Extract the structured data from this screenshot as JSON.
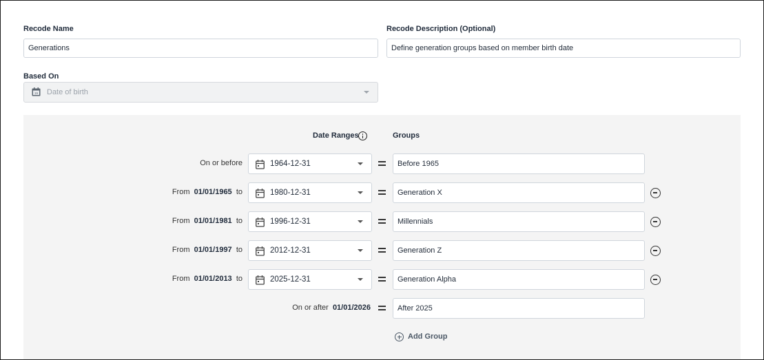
{
  "form": {
    "recode_name_label": "Recode Name",
    "recode_name_value": "Generations",
    "description_label": "Recode Description (Optional)",
    "description_value": "Define generation groups based on member birth date",
    "based_on_label": "Based On",
    "based_on_value": "Date of birth"
  },
  "table": {
    "date_ranges_header": "Date Ranges",
    "groups_header": "Groups",
    "add_group_label": "Add Group",
    "rows": [
      {
        "prefix": "On or before",
        "from": "",
        "to_word": "",
        "date": "1964-12-31",
        "group": "Before 1965",
        "removable": false
      },
      {
        "prefix": "From",
        "from": "01/01/1965",
        "to_word": "to",
        "date": "1980-12-31",
        "group": "Generation X",
        "removable": true
      },
      {
        "prefix": "From",
        "from": "01/01/1981",
        "to_word": "to",
        "date": "1996-12-31",
        "group": "Millennials",
        "removable": true
      },
      {
        "prefix": "From",
        "from": "01/01/1997",
        "to_word": "to",
        "date": "2012-12-31",
        "group": "Generation Z",
        "removable": true
      },
      {
        "prefix": "From",
        "from": "01/01/2013",
        "to_word": "to",
        "date": "2025-12-31",
        "group": "Generation Alpha",
        "removable": true
      }
    ],
    "last_row": {
      "prefix": "On or after",
      "date": "01/01/2026",
      "group": "After 2025"
    }
  },
  "icons": {
    "calendar": "calendar-icon",
    "info": "info-icon",
    "remove": "remove-circle-icon",
    "add": "add-circle-icon"
  }
}
